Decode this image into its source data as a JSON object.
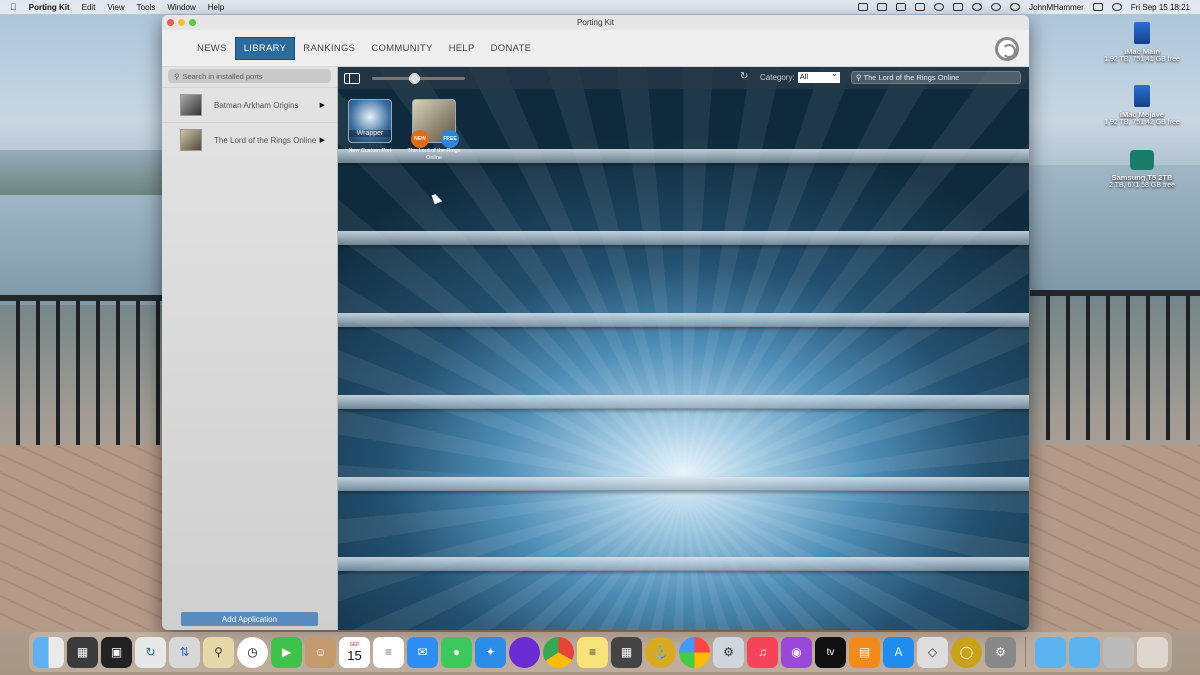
{
  "menubar": {
    "app_name": "Porting Kit",
    "menus": [
      "Edit",
      "View",
      "Tools",
      "Window",
      "Help"
    ],
    "user": "JohnMHammer",
    "clock": "Fri Sep 15  18:21"
  },
  "desktop": {
    "drives": [
      {
        "name": "iMac Main",
        "info": "1.92 TB, 751.41 GB free"
      },
      {
        "name": "iMac Mojave",
        "info": "1.92 TB, 751.42 GB free"
      },
      {
        "name": "Samsung T5 2TB",
        "info": "2 TB, 671.58 GB free"
      }
    ]
  },
  "window": {
    "title": "Porting Kit",
    "tabs": [
      "NEWS",
      "LIBRARY",
      "RANKINGS",
      "COMMUNITY",
      "HELP",
      "DONATE"
    ],
    "active_tab": "LIBRARY"
  },
  "sidebar": {
    "search_placeholder": "Search in installed ports",
    "ports": [
      {
        "name": "Batman Arkham Origins"
      },
      {
        "name": "The Lord of the Rings Online"
      }
    ],
    "add_button": "Add Application"
  },
  "content": {
    "zoom_level": 0.45,
    "category_label": "Category:",
    "category_value": "All",
    "search_value": "The Lord of the Rings Online",
    "items": [
      {
        "caption": "New Custom Port",
        "art_label": "Wrapper",
        "icon": "wrapper-icon"
      },
      {
        "caption": "The Lord of the Rings Online",
        "badges": [
          "NEW",
          "FREE"
        ],
        "icon": "game-art"
      }
    ]
  },
  "dock": {
    "apps": [
      "Finder",
      "Launchpad",
      "Mission Control",
      "Porting Kit",
      "Migration Assistant",
      "Preview",
      "Clock",
      "FaceTime",
      "Contacts",
      "Calendar",
      "Reminders",
      "Mail",
      "Messages",
      "Safari",
      "Firefox",
      "Chrome",
      "Notes",
      "Calculator",
      "Archive",
      "Photos",
      "Disk Utility",
      "Music",
      "Podcasts",
      "TV",
      "Books",
      "App Store",
      "Sketch",
      "One Ring",
      "System Preferences"
    ],
    "calendar_month": "SEP",
    "calendar_day": "15"
  },
  "colors": {
    "accent": "#2d6b9c",
    "add_button": "#5a8bbf"
  }
}
